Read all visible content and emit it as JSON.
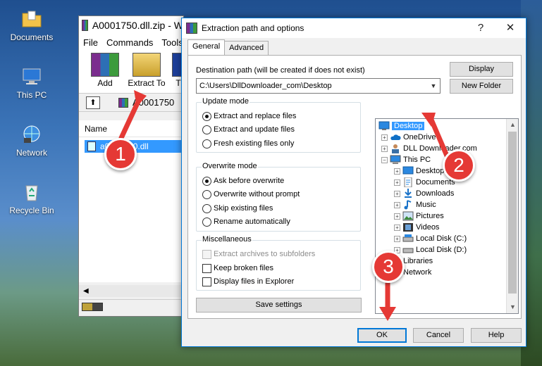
{
  "desktop": {
    "icons": [
      {
        "label": "Documents"
      },
      {
        "label": "This PC"
      },
      {
        "label": "Network"
      },
      {
        "label": "Recycle Bin"
      }
    ]
  },
  "winrar": {
    "title": "A0001750.dll.zip - W",
    "menu": [
      "File",
      "Commands",
      "Tools"
    ],
    "toolbar": {
      "add": "Add",
      "extract_to": "Extract To",
      "extra": "T"
    },
    "path": "A0001750",
    "column_name": "Name",
    "selected_file": "a0001750.dll"
  },
  "dialog": {
    "title": "Extraction path and options",
    "help_btn": "?",
    "close_btn": "✕",
    "tabs": [
      "General",
      "Advanced"
    ],
    "destination_label": "Destination path (will be created if does not exist)",
    "destination_value": "C:\\Users\\DllDownloader_com\\Desktop",
    "display_btn": "Display",
    "new_folder_btn": "New Folder",
    "update_mode": {
      "legend": "Update mode",
      "options": [
        "Extract and replace files",
        "Extract and update files",
        "Fresh existing files only"
      ]
    },
    "overwrite_mode": {
      "legend": "Overwrite mode",
      "options": [
        "Ask before overwrite",
        "Overwrite without prompt",
        "Skip existing files",
        "Rename automatically"
      ]
    },
    "misc": {
      "legend": "Miscellaneous",
      "options": [
        "Extract archives to subfolders",
        "Keep broken files",
        "Display files in Explorer"
      ]
    },
    "save_settings": "Save settings",
    "tree": [
      {
        "label": "Desktop"
      },
      {
        "label": "OneDrive"
      },
      {
        "label": "DLL Downloader.com"
      },
      {
        "label": "This PC"
      },
      {
        "label": "Desktop"
      },
      {
        "label": "Documents"
      },
      {
        "label": "Downloads"
      },
      {
        "label": "Music"
      },
      {
        "label": "Pictures"
      },
      {
        "label": "Videos"
      },
      {
        "label": "Local Disk (C:)"
      },
      {
        "label": "Local Disk (D:)"
      },
      {
        "label": "Libraries"
      },
      {
        "label": "Network"
      }
    ],
    "ok": "OK",
    "cancel": "Cancel",
    "help": "Help"
  },
  "annotations": {
    "step1": "1",
    "step2": "2",
    "step3": "3"
  },
  "colors": {
    "accent": "#0078d7",
    "selection": "#3399ff",
    "marker": "#e53935"
  }
}
